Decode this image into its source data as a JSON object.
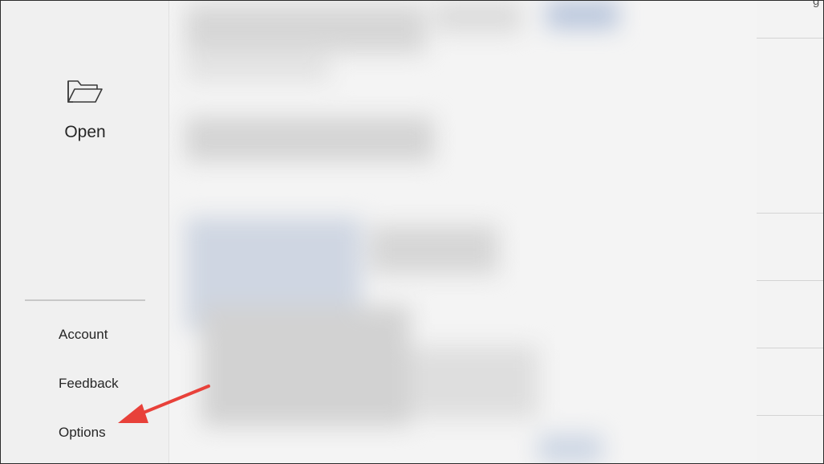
{
  "sidebar": {
    "open": {
      "icon": "folder-open-icon",
      "label": "Open"
    },
    "items": [
      {
        "label": "Account"
      },
      {
        "label": "Feedback"
      },
      {
        "label": "Options"
      }
    ]
  },
  "right_column": {
    "glyph": "g"
  },
  "annotation": {
    "icon": "red-arrow-icon",
    "color": "#e8413a",
    "target": "Options"
  },
  "colors": {
    "sidebar_bg": "#f0f0f0",
    "main_bg": "#f4f4f4",
    "text": "#262626",
    "arrow": "#e8413a"
  }
}
